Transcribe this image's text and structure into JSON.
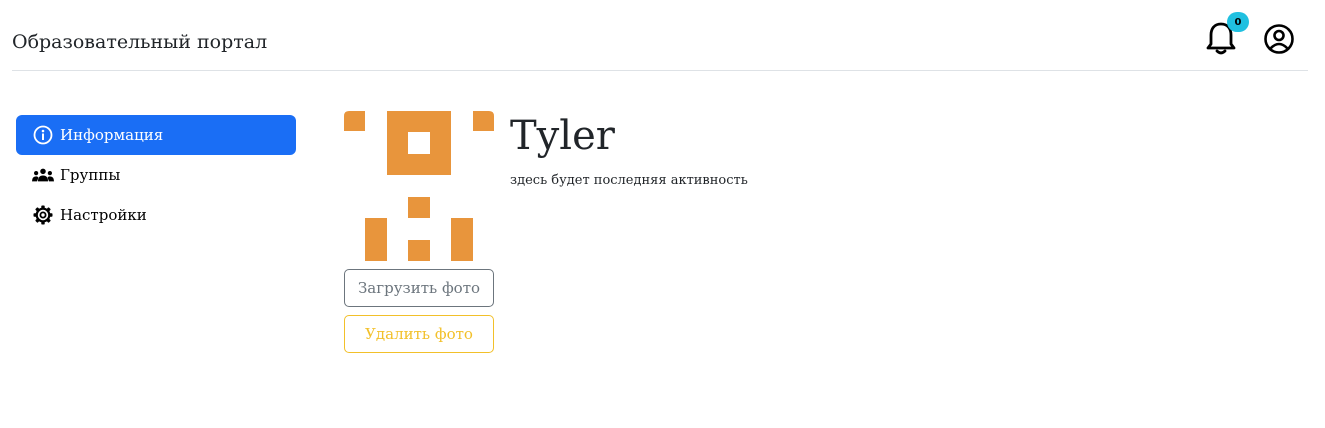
{
  "header": {
    "brand": "Образовательный портал",
    "notifications_count": "0"
  },
  "sidebar": {
    "items": [
      {
        "label": "Информация",
        "icon": "info-icon",
        "active": true
      },
      {
        "label": "Группы",
        "icon": "people-icon",
        "active": false
      },
      {
        "label": "Настройки",
        "icon": "gear-icon",
        "active": false
      }
    ]
  },
  "profile": {
    "username": "Tyler",
    "activity": "здесь будет последняя активность",
    "upload_label": "Загрузить фото",
    "delete_label": "Удалить фото",
    "avatar_color": "#e8953c"
  },
  "colors": {
    "accent": "#1a6ef5",
    "badge": "#20c0e0",
    "warning": "#f2c02a",
    "secondary": "#6c757d"
  }
}
